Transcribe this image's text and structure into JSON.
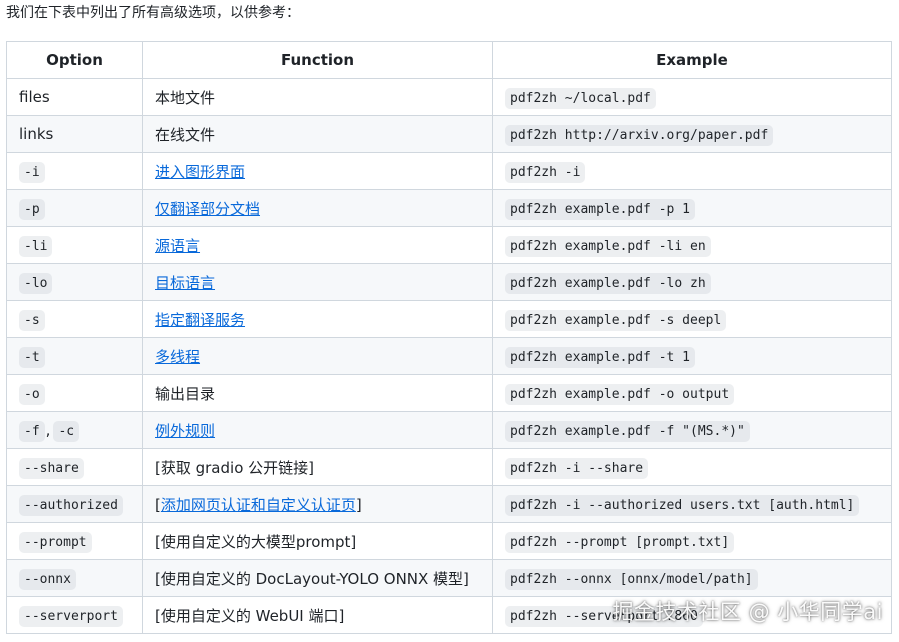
{
  "intro": "我们在下表中列出了所有高级选项，以供参考：",
  "headers": {
    "option": "Option",
    "function": "Function",
    "example": "Example"
  },
  "rows": [
    {
      "option": "files",
      "option_code": false,
      "function": "本地文件",
      "function_link": false,
      "example": "pdf2zh ~/local.pdf"
    },
    {
      "option": "links",
      "option_code": false,
      "function": "在线文件",
      "function_link": false,
      "example": "pdf2zh http://arxiv.org/paper.pdf"
    },
    {
      "option": "-i",
      "option_code": true,
      "function": "进入图形界面",
      "function_link": true,
      "example": "pdf2zh -i"
    },
    {
      "option": "-p",
      "option_code": true,
      "function": "仅翻译部分文档",
      "function_link": true,
      "example": "pdf2zh example.pdf -p 1"
    },
    {
      "option": "-li",
      "option_code": true,
      "function": "源语言",
      "function_link": true,
      "example": "pdf2zh example.pdf -li en"
    },
    {
      "option": "-lo",
      "option_code": true,
      "function": "目标语言",
      "function_link": true,
      "example": "pdf2zh example.pdf -lo zh"
    },
    {
      "option": "-s",
      "option_code": true,
      "function": "指定翻译服务",
      "function_link": true,
      "example": "pdf2zh example.pdf -s deepl"
    },
    {
      "option": "-t",
      "option_code": true,
      "function": "多线程",
      "function_link": true,
      "example": "pdf2zh example.pdf -t 1"
    },
    {
      "option": "-o",
      "option_code": true,
      "function": "输出目录",
      "function_link": false,
      "example": "pdf2zh example.pdf -o output"
    },
    {
      "option": "-f",
      "option2": "-c",
      "option_sep": ",",
      "option_code": true,
      "function": "例外规则",
      "function_link": true,
      "example": "pdf2zh example.pdf -f \"(MS.*)\""
    },
    {
      "option": "--share",
      "option_code": true,
      "function": "[获取 gradio 公开链接]",
      "function_link": false,
      "example": "pdf2zh -i --share"
    },
    {
      "option": "--authorized",
      "option_code": true,
      "function_prefix": "[",
      "function": "添加网页认证和自定义认证页",
      "function_suffix": "]",
      "function_link": true,
      "example": "pdf2zh -i --authorized users.txt [auth.html]"
    },
    {
      "option": "--prompt",
      "option_code": true,
      "function": "[使用自定义的大模型prompt]",
      "function_link": false,
      "example": "pdf2zh --prompt [prompt.txt]"
    },
    {
      "option": "--onnx",
      "option_code": true,
      "function": "[使用自定义的 DocLayout-YOLO ONNX 模型]",
      "function_link": false,
      "example": "pdf2zh --onnx [onnx/model/path]"
    },
    {
      "option": "--serverport",
      "option_code": true,
      "function": "[使用自定义的 WebUI 端口]",
      "function_link": false,
      "example": "pdf2zh --serverport 7860"
    }
  ],
  "watermark": "掘金技术社区 @ 小华同学ai",
  "colors": {
    "link": "#0969da",
    "border": "#d0d7de",
    "stripe": "#f6f8fa",
    "code_bg": "#eceff1"
  }
}
